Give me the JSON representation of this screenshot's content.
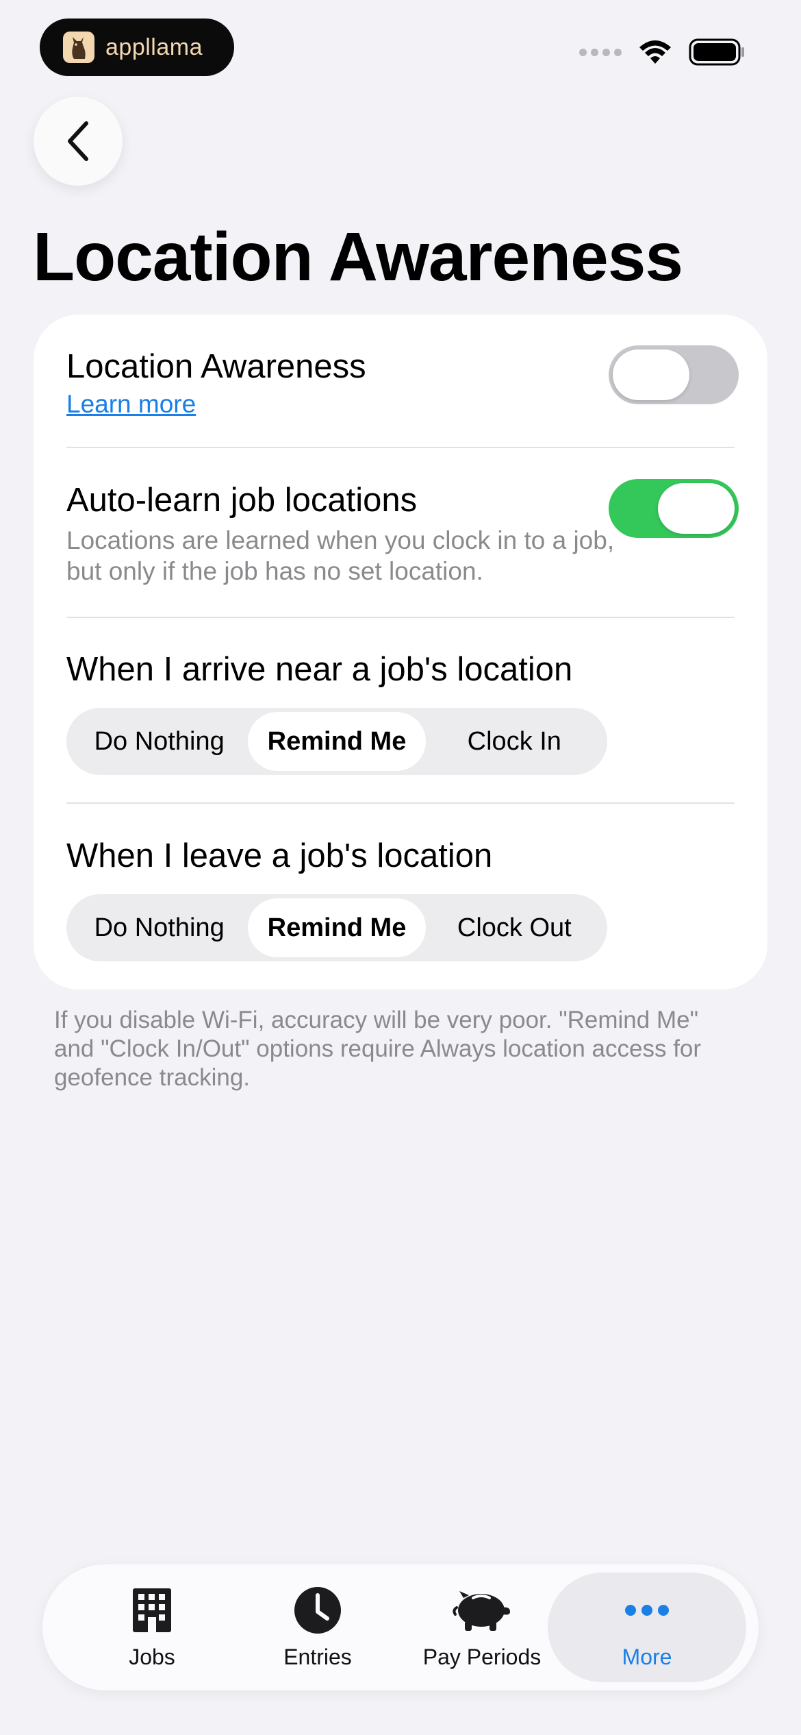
{
  "status_bar": {
    "brand_name": "appllama",
    "icons": [
      "signal-dots-icon",
      "wifi-icon",
      "battery-icon"
    ]
  },
  "nav": {
    "back_icon": "chevron-left-icon"
  },
  "page": {
    "title": "Location Awareness"
  },
  "settings": {
    "location_awareness": {
      "title": "Location Awareness",
      "link": "Learn more",
      "enabled": false
    },
    "auto_learn": {
      "title": "Auto-learn job locations",
      "description": "Locations are learned when you clock in to a job, but only if the job has no set location.",
      "enabled": true
    },
    "arrive": {
      "title": "When I arrive near a job's location",
      "options": [
        "Do Nothing",
        "Remind Me",
        "Clock In"
      ],
      "selected": "Remind Me"
    },
    "leave": {
      "title": "When I leave a job's location",
      "options": [
        "Do Nothing",
        "Remind Me",
        "Clock Out"
      ],
      "selected": "Remind Me"
    }
  },
  "footnote": "If you disable Wi-Fi, accuracy will be very poor. \"Remind Me\" and \"Clock In/Out\" options require Always location access for geofence tracking.",
  "tabbar": {
    "tabs": [
      {
        "label": "Jobs",
        "icon": "building-icon"
      },
      {
        "label": "Entries",
        "icon": "clock-icon"
      },
      {
        "label": "Pay Periods",
        "icon": "piggy-bank-icon"
      },
      {
        "label": "More",
        "icon": "ellipsis-icon"
      }
    ],
    "active": "More"
  },
  "colors": {
    "accent": "#1a7fe6",
    "toggle_on": "#34c759",
    "toggle_off": "#c8c8cc",
    "background": "#f2f2f7"
  }
}
